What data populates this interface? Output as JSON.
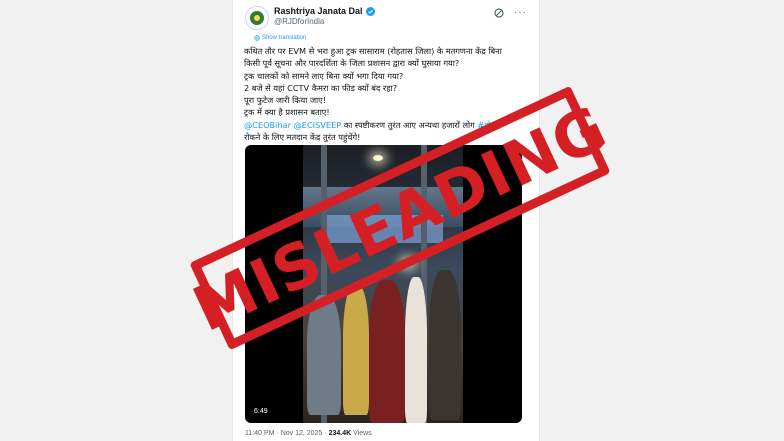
{
  "account": {
    "display_name": "Rashtriya Janata Dal",
    "handle": "@RJDforIndia"
  },
  "icons": [
    "avatar-logo",
    "verified-badge-icon",
    "grok-icon",
    "more-options-icon",
    "globe-icon"
  ],
  "colors": {
    "link": "#1d9bf0",
    "stamp": "#d42024",
    "verified": "#1d9bf0"
  },
  "show_translation_label": "Show translation",
  "tweet_lines": [
    "कथित तौर पर EVM से भरा हुआ ट्रक सासाराम (रोहतास जिला) के मतगणना केंद्र बिना",
    "किसी पूर्व सूचना और पारदर्शिता के जिला प्रशासन द्वारा क्यों घुसाया गया?",
    "ट्रक चालकों को सामने लाए बिना क्यों भगा दिया गया?",
    "2 बजे से यहां CCTV कैमरा का फीड क्यों बंद रहा?",
    "पूरा फुटेज जारी किया जाए!",
    "ट्रक में क्या है प्रशासन बताए!"
  ],
  "tweet_mentions": {
    "mention1": "@CEOBihar",
    "mention2": "@ECISVEEP",
    "text_after": " का स्पष्टीकरण तुरंत आए अन्यथा हजारों लोग ",
    "hashtag": "#वोट",
    "last_line": "रोकने के लिए मतदान केंद्र तुरंत पहुंचेंगे!"
  },
  "media": {
    "duration": "6:49"
  },
  "meta": {
    "time": "11:40 PM",
    "date": "Nov 12, 2025",
    "views": "234.4K",
    "views_label": "Views"
  },
  "stamp_text": "MISLEADING"
}
